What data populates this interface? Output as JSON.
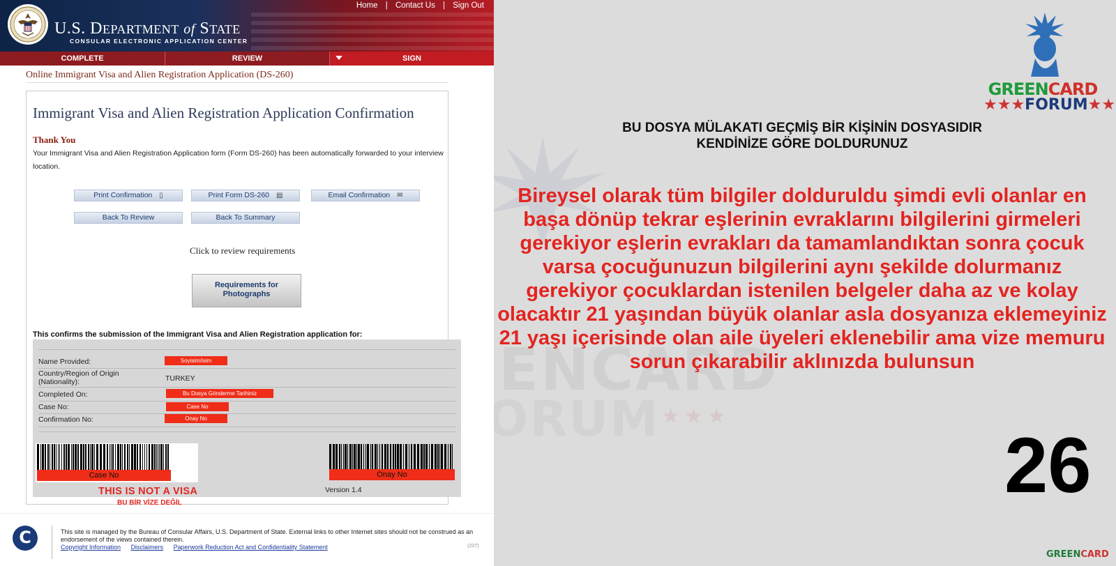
{
  "browser_page": {
    "top_links": [
      "Home",
      "Contact Us",
      "Sign Out"
    ],
    "dept_title_main": "U.S. D",
    "dept_title_rest": "EPARTMENT",
    "dept_title_of": "of",
    "dept_title_state": "S",
    "dept_title_state_rest": "TATE",
    "dept_subtitle": "CONSULAR ELECTRONIC APPLICATION CENTER",
    "nav_tabs": [
      "COMPLETE",
      "REVIEW",
      "SIGN"
    ],
    "form_title": "Online Immigrant Visa and Alien Registration Application (DS-260)",
    "confirmation_title": "Immigrant Visa and Alien Registration Application Confirmation",
    "thank_you": "Thank You",
    "thank_you_text": "Your Immigrant Visa and Alien Registration Application form (Form DS-260) has been automatically forwarded to your interview location.",
    "buttons": {
      "print_confirmation": "Print Confirmation",
      "print_form": "Print Form DS-260",
      "email_confirmation": "Email Confirmation",
      "back_to_review": "Back To Review",
      "back_to_summary": "Back To Summary"
    },
    "click_review": "Click to review requirements",
    "requirements_button": "Requirements for Photographs",
    "confirms_text": "This confirms the submission of the Immigrant Visa and Alien Registration application for:",
    "details": {
      "name_label": "Name Provided:",
      "name_value": "Soyisim/isim",
      "country_label": "Country/Region of Origin (Nationality):",
      "country_value": "TURKEY",
      "completed_label": "Completed On:",
      "completed_value": "Bu Dosya Gönderme Tarihiniz",
      "case_label": "Case No:",
      "case_value": "Case No",
      "confirmation_label": "Confirmation No:",
      "confirmation_value": "Onay No"
    },
    "barcode_left_label": "Case No",
    "barcode_right_label": "Onay No",
    "not_a_visa": "THIS IS NOT A VISA",
    "not_a_visa_tr": "BU BİR VİZE DEĞİL",
    "version": "Version 1.4",
    "footer_text": "This site is managed by the Bureau of Consular Affairs, U.S. Department of State. External links to other Internet sites should not be construed as an endorsement of the views contained therein.",
    "footer_links": [
      "Copyright Information",
      "Disclaimers",
      "Paperwork Reduction Act and Confidentiality Statement"
    ],
    "footer_code": "(227)",
    "footer_logo_letter": "C"
  },
  "slide": {
    "logo_word1_green": "GREEN",
    "logo_word1_red": "CARD",
    "logo_word2": "FORUM",
    "logo_stars": "★★★",
    "heading_line1": "BU DOSYA MÜLAKATI GEÇMİŞ BİR KİŞİNİN DOSYASIDIR",
    "heading_line2": "KENDİNİZE GÖRE DOLDURUNUZ",
    "red_note": "Bireysel olarak tüm bilgiler dolduruldu şimdi evli olanlar en başa dönüp tekrar eşlerinin evraklarını bilgilerini girmeleri gerekiyor eşlerin evrakları da tamamlandıktan sonra çocuk varsa çocuğunuzun bilgilerini aynı şekilde dolurmanız gerekiyor çocuklardan istenilen belgeler daha az ve kolay olacaktır 21 yaşından büyük olanlar asla dosyanıza eklemeyiniz 21 yaşı içerisinde olan aile üyeleri eklenebilir ama vize memuru sorun çıkarabilir aklınızda bulunsun",
    "page_number": "26",
    "small_logo_green": "GREEN",
    "small_logo_red": "CARD",
    "watermark_word1": "GREENCARD",
    "watermark_word2": "FORUM",
    "colors": {
      "red": "#e32420",
      "green": "#1f7a3a",
      "blue": "#1c3a7a"
    }
  }
}
